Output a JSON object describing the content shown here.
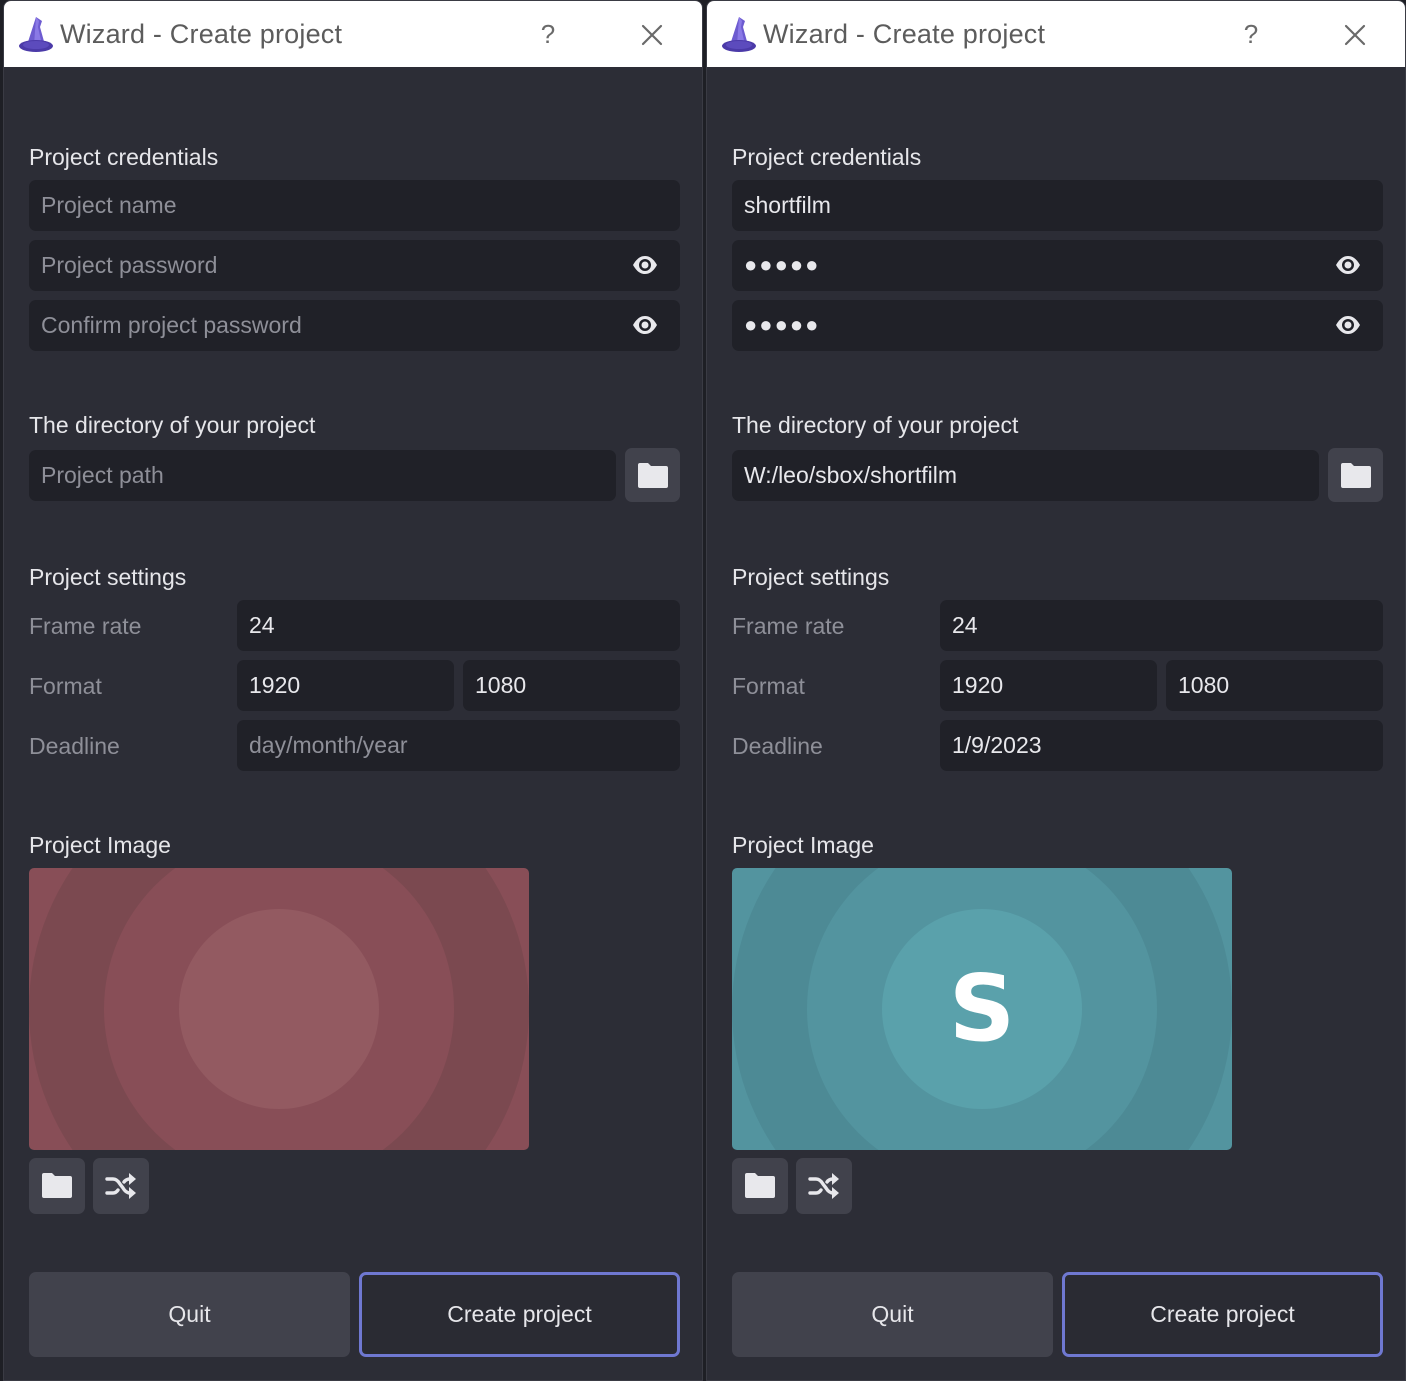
{
  "windows": [
    {
      "title": "Wizard - Create project",
      "help_label": "?",
      "credentials_label": "Project credentials",
      "project_name": {
        "value": "",
        "placeholder": "Project name"
      },
      "project_password": {
        "value": "",
        "placeholder": "Project password"
      },
      "confirm_password": {
        "value": "",
        "placeholder": "Confirm project password"
      },
      "directory_label": "The directory of your project",
      "project_path": {
        "value": "",
        "placeholder": "Project path"
      },
      "settings_label": "Project settings",
      "frame_rate": {
        "label": "Frame rate",
        "value": "24"
      },
      "format": {
        "label": "Format",
        "width": "1920",
        "height": "1080"
      },
      "deadline": {
        "label": "Deadline",
        "value": "",
        "placeholder": "day/month/year"
      },
      "image_label": "Project Image",
      "image": {
        "color": "#884e57",
        "ring_colors": [
          "#7b4950",
          "#884e57",
          "#935a61"
        ],
        "letter": ""
      },
      "quit_label": "Quit",
      "create_label": "Create project"
    },
    {
      "title": "Wizard - Create project",
      "help_label": "?",
      "credentials_label": "Project credentials",
      "project_name": {
        "value": "shortfilm",
        "placeholder": "Project name"
      },
      "project_password": {
        "value": "●●●●●",
        "placeholder": "Project password"
      },
      "confirm_password": {
        "value": "●●●●●",
        "placeholder": "Confirm project password"
      },
      "directory_label": "The directory of your project",
      "project_path": {
        "value": "W:/leo/sbox/shortfilm",
        "placeholder": "Project path"
      },
      "settings_label": "Project settings",
      "frame_rate": {
        "label": "Frame rate",
        "value": "24"
      },
      "format": {
        "label": "Format",
        "width": "1920",
        "height": "1080"
      },
      "deadline": {
        "label": "Deadline",
        "value": "1/9/2023",
        "placeholder": "day/month/year"
      },
      "image_label": "Project Image",
      "image": {
        "color": "#53949f",
        "ring_colors": [
          "#4d8a95",
          "#53949f",
          "#5aa1ab"
        ],
        "letter": "S"
      },
      "quit_label": "Quit",
      "create_label": "Create project"
    }
  ],
  "colors": {
    "accent": "#6f78d1",
    "window_bg": "#2c2d36",
    "field_bg": "#202128"
  },
  "icons": {
    "app": "wizard-hat-icon",
    "help": "question-icon",
    "close": "close-icon",
    "eye": "eye-icon",
    "folder": "folder-icon",
    "shuffle": "shuffle-icon"
  }
}
